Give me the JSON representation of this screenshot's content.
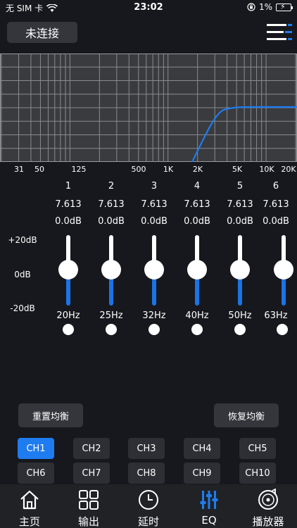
{
  "status_bar": {
    "carrier": "无 SIM 卡",
    "time": "23:02",
    "battery": "1%"
  },
  "header": {
    "connect_label": "未连接",
    "menu_icon": "menu-lines-icon"
  },
  "eq_graph": {
    "freq_labels": [
      "31",
      "50",
      "125",
      "500",
      "1K",
      "2K",
      "5K",
      "10K",
      "20K"
    ],
    "curve": "high-pass rising from about 2K to flat near 5K"
  },
  "db_scale": {
    "top": "+20dB",
    "mid": "0dB",
    "bottom": "-20dB"
  },
  "bands": [
    {
      "num": "1",
      "q": "7.613",
      "gain": "0.0dB",
      "freq": "20Hz"
    },
    {
      "num": "2",
      "q": "7.613",
      "gain": "0.0dB",
      "freq": "25Hz"
    },
    {
      "num": "3",
      "q": "7.613",
      "gain": "0.0dB",
      "freq": "32Hz"
    },
    {
      "num": "4",
      "q": "7.613",
      "gain": "0.0dB",
      "freq": "40Hz"
    },
    {
      "num": "5",
      "q": "7.613",
      "gain": "0.0dB",
      "freq": "50Hz"
    },
    {
      "num": "6",
      "q": "7.613",
      "gain": "0.0dB",
      "freq": "63Hz"
    }
  ],
  "actions": {
    "reset_label": "重置均衡",
    "restore_label": "恢复均衡"
  },
  "channels": {
    "selected": "CH1",
    "row1": [
      "CH1",
      "CH2",
      "CH3",
      "CH4",
      "CH5"
    ],
    "row2": [
      "CH6",
      "CH7",
      "CH8",
      "CH9",
      "CH10"
    ]
  },
  "nav": {
    "items": [
      {
        "label": "主页",
        "icon": "home-icon"
      },
      {
        "label": "输出",
        "icon": "grid-icon"
      },
      {
        "label": "延时",
        "icon": "clock-icon"
      },
      {
        "label": "EQ",
        "icon": "eq-sliders-icon"
      },
      {
        "label": "播放器",
        "icon": "music-disc-icon"
      }
    ],
    "active": "EQ"
  },
  "colors": {
    "background": "#17181d",
    "accent": "#1e7cf0",
    "graph_bg": "#3a3b3f",
    "button_bg": "#34363c"
  }
}
